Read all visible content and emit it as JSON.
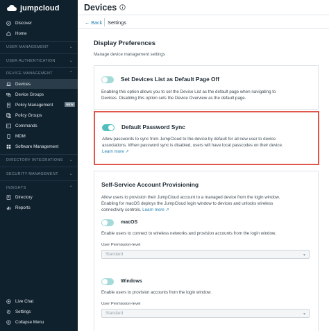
{
  "brand": {
    "name": "jumpcloud"
  },
  "sidebar": {
    "top_items": [
      {
        "label": "Discover",
        "icon": "compass-icon"
      },
      {
        "label": "Home",
        "icon": "home-icon"
      }
    ],
    "sections": {
      "user_management": "USER MANAGEMENT",
      "user_authentication": "USER AUTHENTICATION",
      "device_management": "DEVICE MANAGEMENT",
      "directory_integrations": "DIRECTORY INTEGRATIONS",
      "security_management": "SECURITY MANAGEMENT",
      "insights": "INSIGHTS"
    },
    "device_items": [
      {
        "label": "Devices"
      },
      {
        "label": "Device Groups"
      },
      {
        "label": "Policy Management",
        "badge": "NEW"
      },
      {
        "label": "Policy Groups"
      },
      {
        "label": "Commands"
      },
      {
        "label": "MDM"
      },
      {
        "label": "Software Management"
      }
    ],
    "insight_items": [
      {
        "label": "Directory"
      },
      {
        "label": "Reports"
      }
    ],
    "bottom_items": [
      {
        "label": "Live Chat"
      },
      {
        "label": "Settings"
      },
      {
        "label": "Collapse Menu"
      }
    ]
  },
  "header": {
    "title": "Devices"
  },
  "subheader": {
    "back": "Back",
    "title": "Settings"
  },
  "main": {
    "heading": "Display Preferences",
    "subtitle": "Manage device management settings",
    "card1": {
      "title": "Set Devices List as Default Page Off",
      "toggle_on": false,
      "desc_line1": "Enabling this option allows you to set the Device List as the default page when navigating to",
      "desc_line2": "Devices. Disabling this option sets the Device Overview as the default page."
    },
    "card2": {
      "title": "Default Password Sync",
      "toggle_on": true,
      "desc_line1": "Allow passwords to sync from JumpCloud to the device by default for all new user to device",
      "desc_line2": "associations. When password sync is disabled, users will have local passcodes on their device.",
      "link": "Learn more"
    },
    "card3": {
      "title": "Self-Service Account Provisioning",
      "desc_line1": "Allow users to provision their JumpCloud account to a managed device from the login window.",
      "desc_line2": "Enabling for macOS deploys the JumpCloud login window to devices and unlocks wireless",
      "desc_line3": "connectivity controls.",
      "link": "Learn more",
      "macos": {
        "label": "macOS",
        "desc": "Enable users to connect to wireless networks and provision accounts from the login window.",
        "field_label": "User Permission-level",
        "select_value": "Standard"
      },
      "windows": {
        "label": "Windows",
        "desc": "Enable users to provision accounts from the login window.",
        "field_label": "User Permission-level",
        "select_value": "Standard"
      }
    }
  },
  "colors": {
    "sidebar_bg": "#10212e",
    "accent_teal": "#4fbfbd",
    "highlight_red": "#e0564a",
    "link_blue": "#1f7fb0"
  }
}
